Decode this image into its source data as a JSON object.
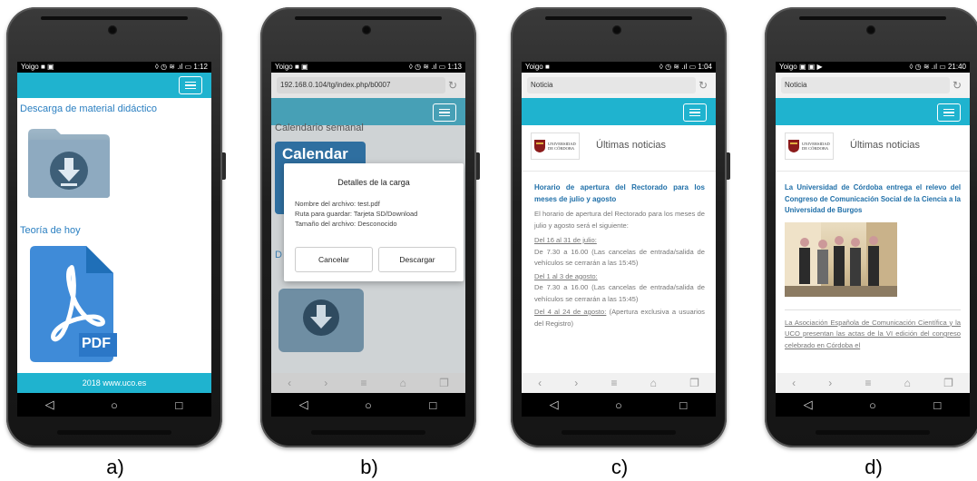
{
  "captions": [
    "a)",
    "b)",
    "c)",
    "d)"
  ],
  "navbar_icons": [
    "◁",
    "○",
    "□"
  ],
  "phones": {
    "a": {
      "status_left": "Yoigo ■ ▣",
      "status_right": "◊ ◷ ≋ .ıl ▭ 1:12",
      "section1_title": "Descarga de material didáctico",
      "section2_title": "Teoría de hoy",
      "pdf_label": "PDF",
      "footer": "2018 www.uco.es"
    },
    "b": {
      "status_left": "Yoigo ■ ▣",
      "status_right": "◊ ◷ ≋ .ıl ▭ 1:13",
      "url": "192.168.0.104/tg/index.php/b0007",
      "bg_heading": "Calendario semanal",
      "bg_calendar": "Calendar",
      "bg_letter": "D",
      "dialog_title": "Detalles de la carga",
      "dialog_line1": "Nombre del archivo: test.pdf",
      "dialog_line2": "Ruta para guardar: Tarjeta SD/Download",
      "dialog_line3": "Tamaño del archivo: Desconocido",
      "cancel": "Cancelar",
      "download": "Descargar"
    },
    "c": {
      "status_left": "Yoigo ■",
      "status_right": "◊ ◷ ≋ .ıl ▭ 1:04",
      "url": "Noticia",
      "logo_text": "UNIVERSIDAD DE CÓRDOBA",
      "header": "Últimas noticias",
      "news_title": "Horario de apertura del Rectorado para los meses de julio y agosto",
      "intro": "El horario de apertura del Rectorado para los meses de julio y agosto será el siguiente:",
      "d1": "Del 16 al 31 de julio:",
      "t1": "De 7.30 a 16.00 (Las cancelas de entrada/salida de vehículos se cerrarán a las 15:45)",
      "d2": "Del 1 al 3 de agosto:",
      "t2": "De 7.30 a 16.00 (Las cancelas de entrada/salida de vehículos se cerrarán a las 15:45)",
      "d3": "Del 4 al 24 de agosto:",
      "t3": "(Apertura exclusiva a usuarios del Registro)"
    },
    "d": {
      "status_left": "Yoigo ▣ ▣ ▶",
      "status_right": "◊ ◷ ≋ .ıl ▭ 21:40",
      "url": "Noticia",
      "logo_text": "UNIVERSIDAD DE CÓRDOBA",
      "header": "Últimas noticias",
      "news_title": "La Universidad de Córdoba entrega el relevo del Congreso de Comunicación Social de la Ciencia a la Universidad de Burgos",
      "link_text": "La Asociación Española de Comunicación Científica y la UCO presentan las actas de la VI edición del congreso celebrado en Córdoba el"
    }
  },
  "colors": {
    "accent": "#1fb3cf",
    "link": "#2a7fc1"
  }
}
